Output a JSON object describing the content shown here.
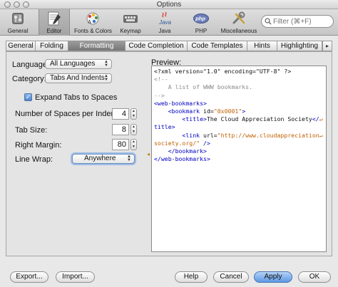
{
  "window": {
    "title": "Options"
  },
  "toolbar": {
    "items": [
      {
        "label": "General",
        "icon": "switch-icon"
      },
      {
        "label": "Editor",
        "icon": "editor-icon"
      },
      {
        "label": "Fonts & Colors",
        "icon": "fonts-colors-icon"
      },
      {
        "label": "Keymap",
        "icon": "keyboard-icon"
      },
      {
        "label": "Java",
        "icon": "java-icon"
      },
      {
        "label": "PHP",
        "icon": "php-icon"
      },
      {
        "label": "Miscellaneous",
        "icon": "tools-icon"
      }
    ],
    "active": "Editor",
    "filter_placeholder": "Filter (⌘+F)",
    "java_logo_text": "Java",
    "php_logo_text": "php"
  },
  "tabs": {
    "items": [
      "General",
      "Folding",
      "Formatting",
      "Code Completion",
      "Code Templates",
      "Hints",
      "Highlighting"
    ],
    "active": "Formatting",
    "overflow_glyph": "▸"
  },
  "form": {
    "language_label": "Language:",
    "language_value": "All Languages",
    "category_label": "Category:",
    "category_value": "Tabs And Indents",
    "expand_tabs_label": "Expand Tabs to Spaces",
    "expand_tabs_checked": true,
    "check_glyph": "✓",
    "spaces_per_indent_label": "Number of Spaces per Indent:",
    "spaces_per_indent_value": "4",
    "tab_size_label": "Tab Size:",
    "tab_size_value": "8",
    "right_margin_label": "Right Margin:",
    "right_margin_value": "80",
    "line_wrap_label": "Line Wrap:",
    "line_wrap_value": "Anywhere",
    "stepper_glyphs": {
      "up": "▲",
      "down": "▼"
    }
  },
  "preview": {
    "label": "Preview:",
    "lines": [
      [
        {
          "t": "<?xml version=\"1.0\" encoding=\"UTF-8\" ?>",
          "c": ""
        }
      ],
      [
        {
          "t": "<!--",
          "c": "c"
        }
      ],
      [
        {
          "t": "    A list of WWW bookmarks.",
          "c": "c"
        }
      ],
      [
        {
          "t": "-->",
          "c": "c"
        }
      ],
      [
        {
          "t": "<web-bookmarks>",
          "c": "k"
        }
      ],
      [
        {
          "t": "    <bookmark ",
          "c": "k"
        },
        {
          "t": "id=",
          "c": ""
        },
        {
          "t": "\"0x0001\"",
          "c": "s"
        },
        {
          "t": ">",
          "c": "k"
        }
      ],
      [
        {
          "t": "        <title>",
          "c": "k"
        },
        {
          "t": "The Cloud Appreciation Society",
          "c": ""
        },
        {
          "t": "</",
          "c": "k"
        },
        {
          "t": "↵",
          "c": "wrap-arrow"
        }
      ],
      [
        {
          "t": "title>",
          "c": "k"
        }
      ],
      [
        {
          "t": "        <link ",
          "c": "k"
        },
        {
          "t": "url=",
          "c": ""
        },
        {
          "t": "\"http://www.cloudappreciation",
          "c": "s"
        },
        {
          "t": "↵",
          "c": "wrap-arrow"
        }
      ],
      [
        {
          "t": "society.org/\"",
          "c": "s"
        },
        {
          "t": " />",
          "c": "k"
        }
      ],
      [
        {
          "t": "    </bookmark>",
          "c": "k"
        }
      ],
      [
        {
          "t": "</web-bookmarks>",
          "c": "k"
        }
      ]
    ]
  },
  "buttons": {
    "export": "Export...",
    "import": "Import...",
    "help": "Help",
    "cancel": "Cancel",
    "apply": "Apply",
    "ok": "OK"
  },
  "colors": {
    "tag": "#0000c0",
    "string": "#c06000",
    "comment": "#8c8c8c",
    "default_button": "#5c98e4"
  }
}
